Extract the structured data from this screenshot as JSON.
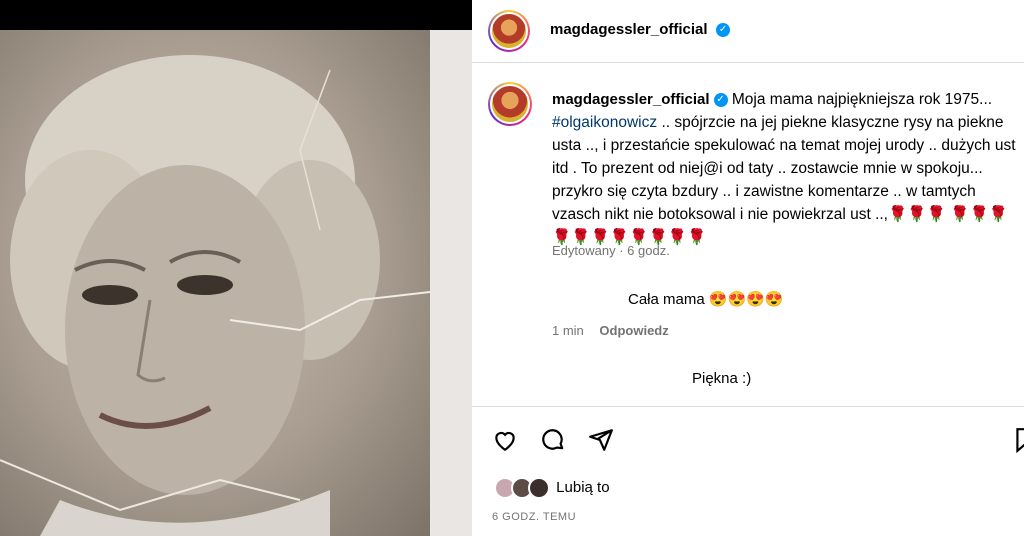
{
  "photo": {
    "alt": ""
  },
  "header": {
    "username": "magdagessler_official"
  },
  "caption": {
    "username": "magdagessler_official",
    "text_line1": "Moja mama najpiękniejsza rok 1975...",
    "tag": "#olgaikonowicz",
    "text_rest": ".. spójrzcie na jej piekne klasyczne rysy na piekne usta .., i przestańcie spekulować na temat mojej urody .. dużych ust itd . To prezent od niej@i od taty .. zostawcie mnie w spokoju... przykro się czyta bzdury .. i zawistne komentarze .. w tamtych vzasch nikt nie botoksowal i nie powiekrzal ust ..,🌹🌹🌹",
    "roses": "🌹🌹🌹🌹🌹🌹🌹🌹🌹🌹🌹",
    "edited": "Edytowany",
    "age": "6 godz."
  },
  "comments": [
    {
      "text": "Cała mama 😍😍😍😍",
      "time": "1 min",
      "reply": "Odpowiedz"
    },
    {
      "text": "Piękna :)"
    }
  ],
  "actions": {
    "likes_label": "Lubią to",
    "timestamp": "6 GODZ. TEMU"
  },
  "colors": {
    "verified": "#0095f6",
    "tag": "#00376b",
    "muted": "#737373"
  }
}
